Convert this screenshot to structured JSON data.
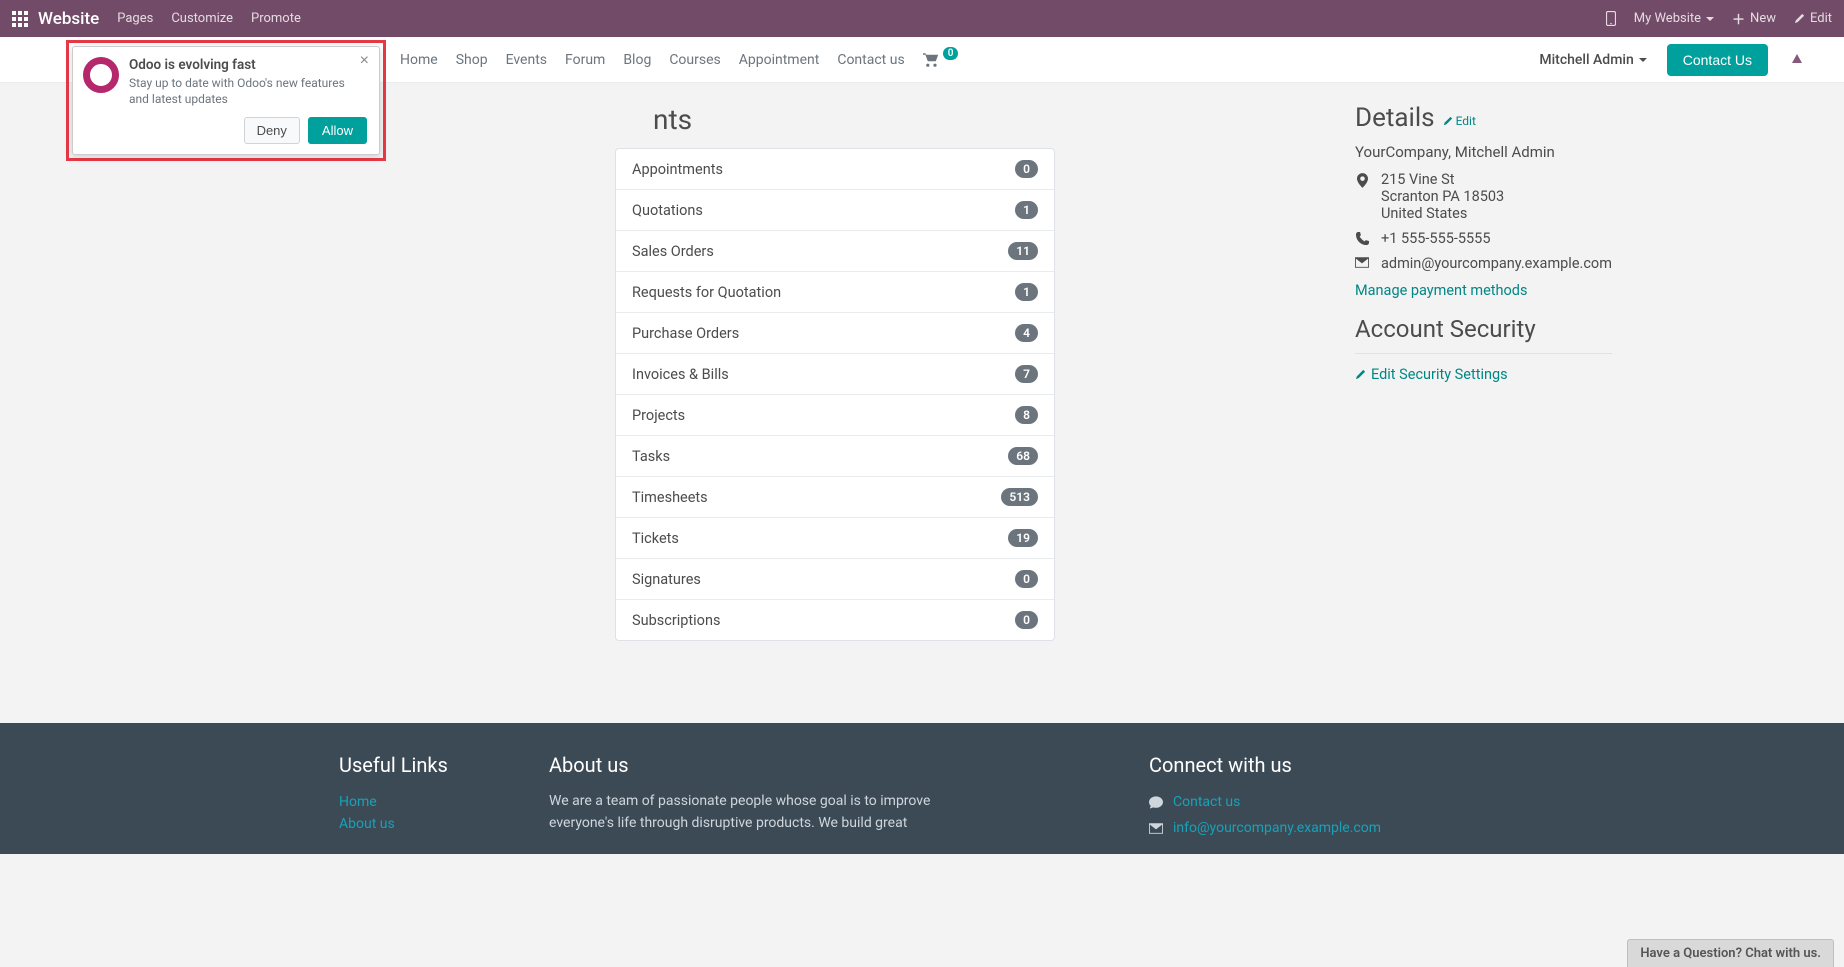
{
  "admin": {
    "title": "Website",
    "menu": [
      "Pages",
      "Customize",
      "Promote"
    ],
    "right": {
      "my_website": "My Website",
      "new": "New",
      "edit": "Edit"
    }
  },
  "nav": {
    "items": [
      "Home",
      "Shop",
      "Events",
      "Forum",
      "Blog",
      "Courses",
      "Appointment",
      "Contact us"
    ],
    "cart_count": "0",
    "user": "Mitchell Admin",
    "contact_btn": "Contact Us"
  },
  "notif": {
    "title": "Odoo is evolving fast",
    "body": "Stay up to date with Odoo's new features and latest updates",
    "deny": "Deny",
    "allow": "Allow"
  },
  "page": {
    "title_partial": "nts",
    "items": [
      {
        "label": "Appointments",
        "count": "0"
      },
      {
        "label": "Quotations",
        "count": "1"
      },
      {
        "label": "Sales Orders",
        "count": "11"
      },
      {
        "label": "Requests for Quotation",
        "count": "1"
      },
      {
        "label": "Purchase Orders",
        "count": "4"
      },
      {
        "label": "Invoices & Bills",
        "count": "7"
      },
      {
        "label": "Projects",
        "count": "8"
      },
      {
        "label": "Tasks",
        "count": "68"
      },
      {
        "label": "Timesheets",
        "count": "513"
      },
      {
        "label": "Tickets",
        "count": "19"
      },
      {
        "label": "Signatures",
        "count": "0"
      },
      {
        "label": "Subscriptions",
        "count": "0"
      }
    ]
  },
  "details": {
    "heading": "Details",
    "edit": "Edit",
    "company": "YourCompany, Mitchell Admin",
    "addr1": "215 Vine St",
    "addr2": "Scranton PA 18503",
    "addr3": "United States",
    "phone": "+1 555-555-5555",
    "email": "admin@yourcompany.example.com",
    "manage_payment": "Manage payment methods",
    "security_heading": "Account Security",
    "security_link": "Edit Security Settings"
  },
  "footer": {
    "links_h": "Useful Links",
    "links": [
      "Home",
      "About us"
    ],
    "about_h": "About us",
    "about_p": "We are a team of passionate people whose goal is to improve everyone's life through disruptive products. We build great",
    "connect_h": "Connect with us",
    "contact_us": "Contact us",
    "info_email": "info@yourcompany.example.com"
  },
  "chat": "Have a Question? Chat with us."
}
